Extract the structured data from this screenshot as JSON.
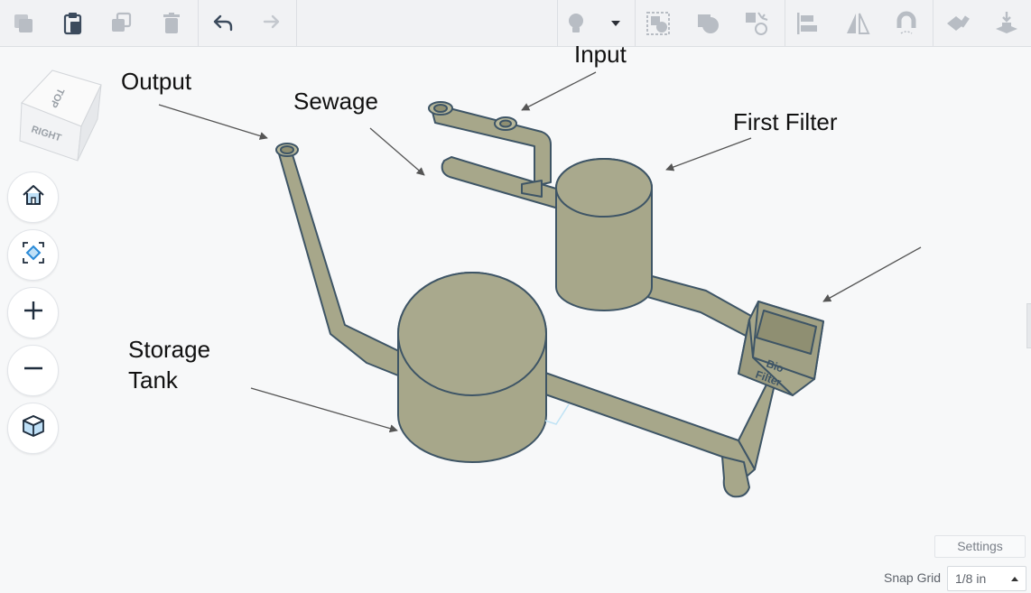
{
  "toolbar": {
    "left_tools": [
      {
        "name": "copy-icon"
      },
      {
        "name": "paste-icon"
      },
      {
        "name": "duplicate-icon"
      },
      {
        "name": "delete-icon"
      },
      {
        "name": "undo-icon"
      },
      {
        "name": "redo-icon"
      }
    ],
    "right_tools": [
      {
        "name": "lightbulb-icon"
      },
      {
        "name": "dropdown-caret-icon"
      },
      {
        "name": "group-icon"
      },
      {
        "name": "solid-hole-icon"
      },
      {
        "name": "ungroup-icon"
      },
      {
        "name": "align-icon"
      },
      {
        "name": "mirror-icon"
      },
      {
        "name": "magnet-icon"
      },
      {
        "name": "workplane-icon"
      },
      {
        "name": "drop-icon"
      }
    ]
  },
  "viewcube": {
    "top_face": "TOP",
    "right_face": "RIGHT"
  },
  "nav": [
    "home-icon",
    "fit-view-icon",
    "zoom-in-icon",
    "zoom-out-icon",
    "perspective-cube-icon"
  ],
  "labels": {
    "output": "Output",
    "sewage": "Sewage",
    "input": "Input",
    "first_filter": "First Filter",
    "storage_line1": "Storage",
    "storage_line2": "Tank"
  },
  "model_text": {
    "line1": "Bio",
    "line2": "Filter"
  },
  "bottom": {
    "settings": "Settings",
    "snap_grid_label": "Snap Grid",
    "snap_grid_value": "1/8 in"
  },
  "colors": {
    "model_fill": "#a7a78a",
    "model_stroke": "#3e5566",
    "toolbar_icon": "#b8bdc4",
    "toolbar_icon_active": "#3c4b5d",
    "accent_blue": "#2a8ad8"
  }
}
